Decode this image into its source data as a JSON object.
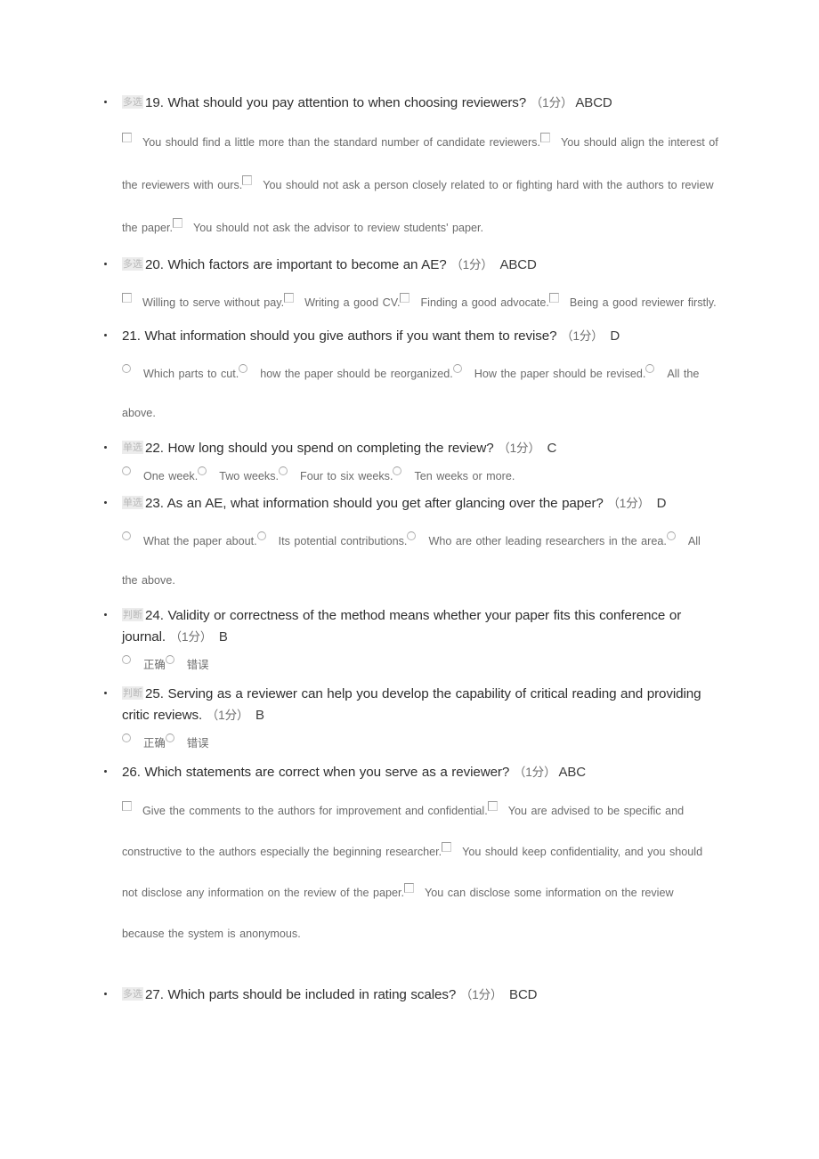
{
  "document": {
    "score_marker": "（1分）",
    "true_label": "正确",
    "false_label": "错误",
    "badge_multi": "多选",
    "badge_single": "单选",
    "badge_judge": "判断"
  },
  "questions": [
    {
      "badge": "多选",
      "number": "19.",
      "text": "What should you pay attention to when choosing reviewers?",
      "score": "（1分）",
      "answer": "ABCD",
      "input_type": "checkbox",
      "options": [
        "You should find a little more than the standard number of candidate reviewers.",
        "You should align the interest of the reviewers with ours.",
        "You should not ask a person closely related to or fighting hard with the authors to review the paper.",
        "You should not ask the advisor to review students' paper."
      ]
    },
    {
      "badge": "多选",
      "number": "20.",
      "text": "Which factors are important to become an AE?",
      "score": "（1分）",
      "answer": "ABCD",
      "input_type": "checkbox",
      "options": [
        "Willing to serve without pay.",
        "Writing a good CV.",
        "Finding a good advocate.",
        "Being a good reviewer firstly."
      ]
    },
    {
      "badge": "",
      "number": "21.",
      "text": "What information should you give authors if you want them to revise?",
      "score": "（1分）",
      "answer": "D",
      "input_type": "radio",
      "options": [
        "Which parts to cut.",
        "how the paper should be reorganized.",
        "How the paper should be revised.",
        "All the above."
      ]
    },
    {
      "badge": "单选",
      "number": "22.",
      "text": "How long should you spend on completing the review?",
      "score": "（1分）",
      "answer": "C",
      "input_type": "radio",
      "options": [
        "One week.",
        "Two weeks.",
        "Four to six weeks.",
        "Ten weeks or more."
      ]
    },
    {
      "badge": "单选",
      "number": "23.",
      "text": "As an AE, what information should you get after glancing over the paper?",
      "score": "（1分）",
      "answer": "D",
      "input_type": "radio",
      "options": [
        "What the paper about.",
        "Its potential contributions.",
        "Who are other leading researchers in the area.",
        "All the above."
      ]
    },
    {
      "badge": "判断",
      "number": "24.",
      "text": "Validity or correctness of the method means whether your paper fits this conference or journal.",
      "score": "（1分）",
      "answer": "B",
      "input_type": "radio",
      "options": [
        "正确",
        "错误"
      ]
    },
    {
      "badge": "判断",
      "number": "25.",
      "text": "Serving as a reviewer can help you develop the capability of critical reading and providing critic reviews.",
      "score": "（1分）",
      "answer": "B",
      "input_type": "radio",
      "options": [
        "正确",
        "错误"
      ]
    },
    {
      "badge": "",
      "number": "26.",
      "text": "Which statements are correct when you serve as a reviewer?",
      "score": "（1分）",
      "answer": "ABC",
      "input_type": "checkbox",
      "options": [
        "Give the comments to the authors for improvement and confidential.",
        "You are advised to be specific and constructive to the authors especially the beginning researcher.",
        "You should keep confidentiality, and you should not disclose any information on the review of the paper.",
        "You can disclose some information on the review because the system is anonymous."
      ]
    },
    {
      "badge": "多选",
      "number": "27.",
      "text": "Which parts should be included in rating scales?",
      "score": "（1分）",
      "answer": "BCD",
      "input_type": "checkbox",
      "options": []
    }
  ]
}
